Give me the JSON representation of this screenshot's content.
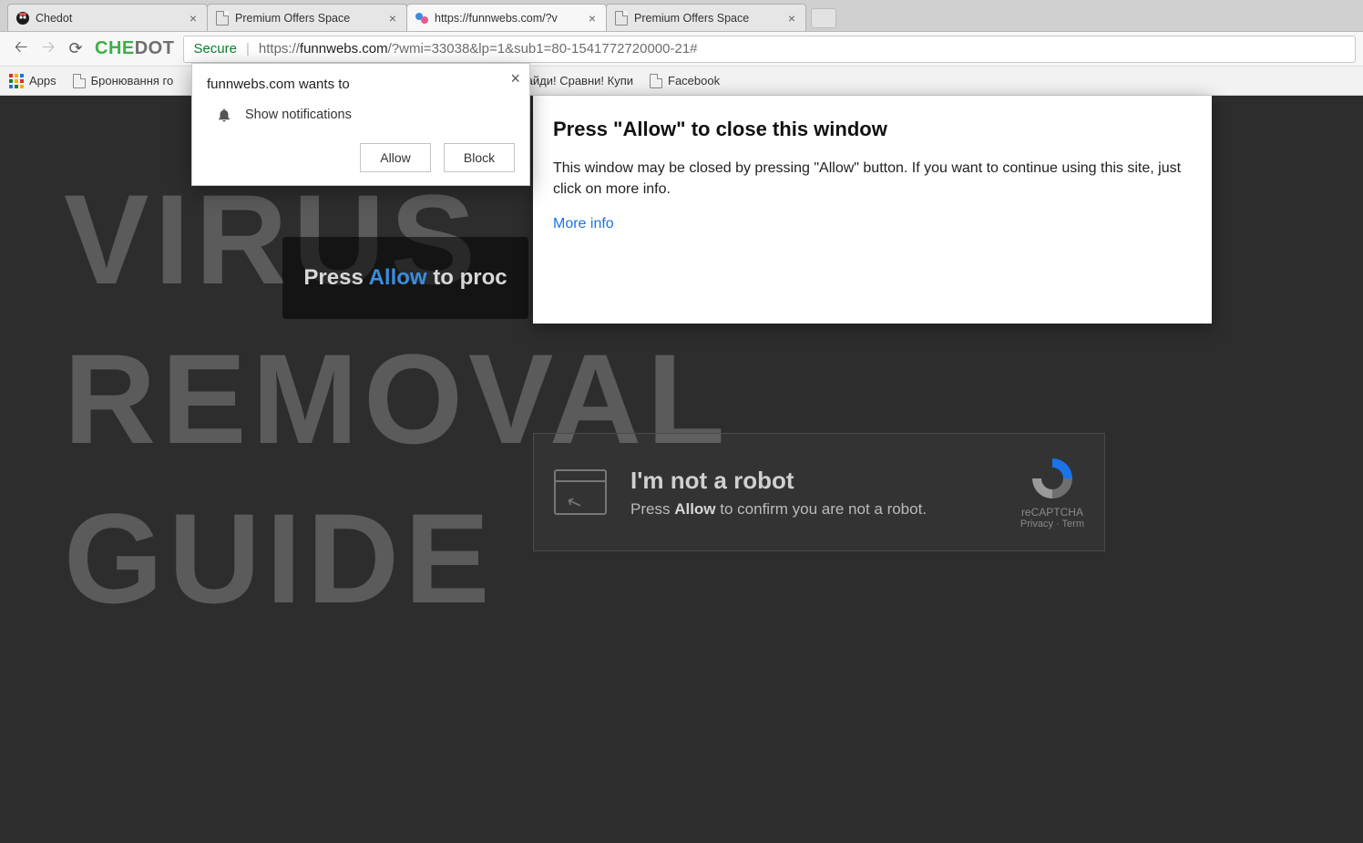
{
  "tabs": [
    {
      "title": "Chedot",
      "favicon": "chedot"
    },
    {
      "title": "Premium Offers Space",
      "favicon": "doc"
    },
    {
      "title": "https://funnwebs.com/?v",
      "favicon": "color",
      "active": true
    },
    {
      "title": "Premium Offers Space",
      "favicon": "doc"
    }
  ],
  "toolbar": {
    "brand_part1": "CHE",
    "brand_part2": "DOT",
    "secure_label": "Secure",
    "url_prefix": "https://",
    "url_domain": "funnwebs.com",
    "url_rest": "/?wmi=33038&lp=1&sub1=80-1541772720000-21#"
  },
  "bookmarks": {
    "apps": "Apps",
    "items": [
      "Бронювання го",
      "Найди! Сравни! Купи",
      "Facebook"
    ]
  },
  "watermark": {
    "line1": "VIRUS",
    "line2": "REMOVAL",
    "line3": "GUIDE"
  },
  "behind_prompt": {
    "pre": "Press ",
    "allow": "Allow",
    "post": " to proc"
  },
  "overlay": {
    "heading": "Press \"Allow\" to close this window",
    "body": "This window may be closed by pressing \"Allow\" button. If you want to continue using this site, just click on more info.",
    "link": "More info"
  },
  "captcha": {
    "heading": "I'm not a robot",
    "line_pre": "Press ",
    "line_bold": "Allow",
    "line_post": " to confirm you are not a robot.",
    "badge_label": "reCAPTCHA",
    "badge_sub": "Privacy · Term"
  },
  "permission": {
    "title": "funnwebs.com wants to",
    "item": "Show notifications",
    "allow": "Allow",
    "block": "Block"
  }
}
